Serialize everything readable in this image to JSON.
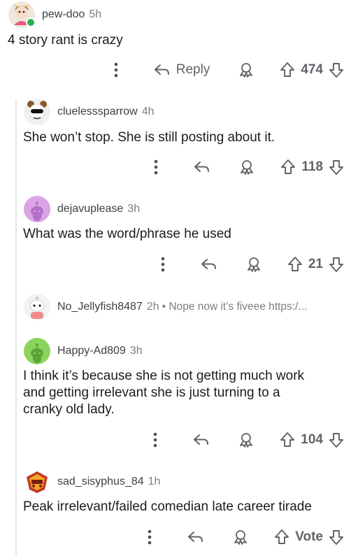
{
  "comments": [
    {
      "username": "pew-doo",
      "age": "5h",
      "body": "4 story rant is crazy",
      "reply_label": "Reply",
      "score": "474"
    },
    {
      "username": "cluelesssparrow",
      "age": "4h",
      "body": "She won’t stop. She is still posting about it.",
      "score": "118"
    },
    {
      "username": "dejavuplease",
      "age": "3h",
      "body": "What was the word/phrase he used",
      "score": "21"
    },
    {
      "username": "No_Jellyfish8487",
      "age": "2h",
      "preview": "• Nope now it’s fiveee https:/...",
      "score": ""
    },
    {
      "username": "Happy-Ad809",
      "age": "3h",
      "body_lines": [
        "I think it’s because she is not getting much work",
        "and getting irrelevant she is just turning to a",
        "cranky old lady."
      ],
      "score": "104"
    },
    {
      "username": "sad_sisyphus_84",
      "age": "1h",
      "body": "Peak irrelevant/failed comedian late career tirade",
      "score": "Vote"
    }
  ],
  "icons": {
    "more": "more-vertical-icon",
    "reply": "reply-arrow-icon",
    "award": "award-icon",
    "upvote": "upvote-arrow-icon",
    "downvote": "downvote-arrow-icon"
  },
  "colors": {
    "background": "#ffffff",
    "text": "#1c1c1c",
    "muted": "#7c7f84",
    "icon": "#5f6368",
    "online": "#2bb04a",
    "thread_line": "#e6e8ea"
  }
}
